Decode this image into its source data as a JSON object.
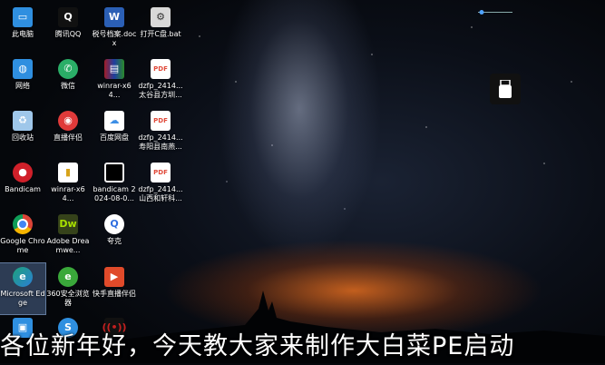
{
  "desktop_icons": [
    {
      "label": "此电脑",
      "icon": "this-pc-icon",
      "color": "#2f8fe0"
    },
    {
      "label": "网络",
      "icon": "network-icon",
      "color": "#2f8fe0"
    },
    {
      "label": "回收站",
      "icon": "recycle-bin-icon",
      "color": "#9fc7ea"
    },
    {
      "label": "Bandicam",
      "icon": "bandicam-icon",
      "color": "#d0202a"
    },
    {
      "label": "Google Chrome",
      "icon": "chrome-icon",
      "color": "#e8b400"
    },
    {
      "label": "Microsoft Edge",
      "icon": "edge-icon",
      "color": "#1da27b"
    },
    {
      "label": "",
      "icon": "app-icon",
      "color": "#2f8fe0"
    },
    {
      "label": "腾讯QQ",
      "icon": "qq-icon",
      "color": "#111111"
    },
    {
      "label": "微信",
      "icon": "wechat-icon",
      "color": "#2aae67"
    },
    {
      "label": "直播伴侣",
      "icon": "live-companion-icon",
      "color": "#e03a3a"
    },
    {
      "label": "winrar-x64...",
      "icon": "winrar-icon",
      "color": "#d7a31a"
    },
    {
      "label": "Adobe Dreamwe...",
      "icon": "dreamweaver-icon",
      "color": "#35421a"
    },
    {
      "label": "360安全浏览器",
      "icon": "360-browser-icon",
      "color": "#3aa83a"
    },
    {
      "label": "",
      "icon": "app-icon",
      "color": "#2f8fe0"
    },
    {
      "label": "税号档案.docx",
      "icon": "word-doc-icon",
      "color": "#2b5fb5"
    },
    {
      "label": "winrar-x64...",
      "icon": "winrar-icon",
      "color": "#a01e2a"
    },
    {
      "label": "百度网盘",
      "icon": "baidu-netdisk-icon",
      "color": "#3d8fe6"
    },
    {
      "label": "bandicam 2024-08-0...",
      "icon": "video-file-icon",
      "color": "#f2f2f2"
    },
    {
      "label": "夸克",
      "icon": "quark-icon",
      "color": "#2f6ee0"
    },
    {
      "label": "快手直播伴侣",
      "icon": "kuaishou-icon",
      "color": "#e04a2a"
    },
    {
      "label": "",
      "icon": "app-icon",
      "color": "#c42020"
    },
    {
      "label": "打开C盘.bat",
      "icon": "bat-file-icon",
      "color": "#d8d8d8"
    },
    {
      "label": "dzfp_2414... 太谷县方圳...",
      "icon": "pdf-icon",
      "color": "#e04a3a"
    },
    {
      "label": "dzfp_2414... 寿阳县南燕...",
      "icon": "pdf-icon",
      "color": "#e04a3a"
    },
    {
      "label": "dzfp_2414... 山西和轩科...",
      "icon": "pdf-icon",
      "color": "#e04a3a"
    }
  ],
  "caption": "各位新年好，今天教大家来制作大白菜PE启动",
  "usb_icon": "usb-drive-icon"
}
